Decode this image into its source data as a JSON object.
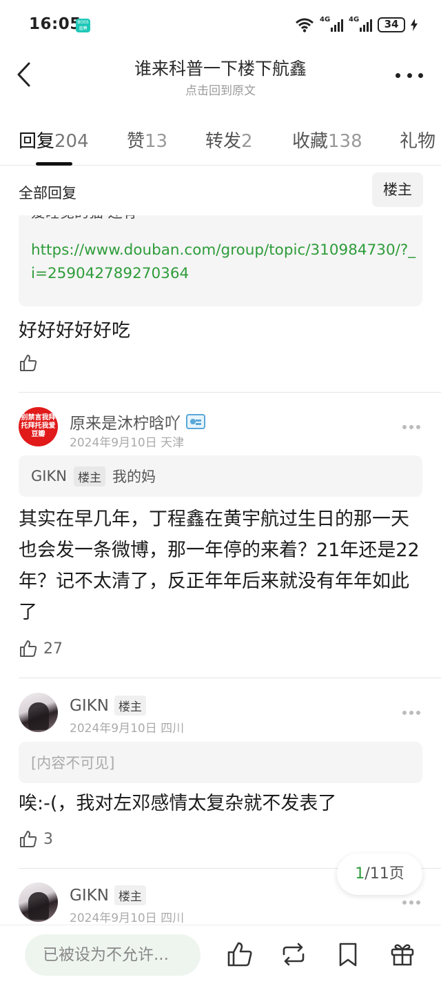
{
  "status_bar": {
    "time": "16:05",
    "boss_badge": "BOSS直聘",
    "net1": "4G",
    "net2": "4G",
    "battery": "34"
  },
  "header": {
    "title": "谁来科普一下楼下航鑫",
    "subtitle": "点击回到原文"
  },
  "tabs": [
    {
      "label": "回复",
      "count": "204"
    },
    {
      "label": "赞",
      "count": "13"
    },
    {
      "label": "转发",
      "count": "2"
    },
    {
      "label": "收藏",
      "count": "138"
    },
    {
      "label": "礼物",
      "count": ""
    }
  ],
  "filter": {
    "label": "全部回复",
    "owner_button": "楼主"
  },
  "posts": [
    {
      "quote_cut": "爱睡觉的猫 还有",
      "quote_link": "https://www.douban.com/group/topic/310984730/?_i=259042789270364",
      "text": "好好好好好吃",
      "likes": ""
    },
    {
      "avatar_text": "别禁言我拜托拜托我爱豆瓣",
      "author": "原来是沐柠晗吖",
      "date_loc": "2024年9月10日 天津",
      "quote_author": "GIKN",
      "quote_badge": "楼主",
      "quote_text": "我的妈",
      "text": "其实在早几年，丁程鑫在黄宇航过生日的那一天也会发一条微博，那一年停的来着？21年还是22年？记不太清了，反正年年后来就没有年年如此了",
      "likes": "27"
    },
    {
      "author": "GIKN",
      "badge": "楼主",
      "date_loc": "2024年9月10日 四川",
      "quote_text": "[内容不可见]",
      "text": "唉:-(，我对左邓感情太复杂就不发表了",
      "likes": "3"
    },
    {
      "author": "GIKN",
      "badge": "楼主",
      "date_loc": "2024年9月10日 四川"
    }
  ],
  "pager": {
    "current": "1",
    "total": "/11页"
  },
  "bottom": {
    "input_placeholder": "已被设为不允许..."
  }
}
